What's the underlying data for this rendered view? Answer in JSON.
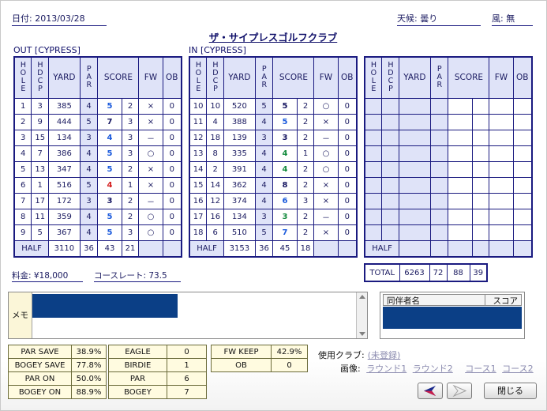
{
  "header": {
    "date": "日付: 2013/03/28",
    "weather": "天候: 曇り",
    "wind": "風: 無",
    "club_name": "ザ・サイプレスゴルフクラブ"
  },
  "sections": {
    "out_label": "OUT [CYPRESS]",
    "in_label": "IN [CYPRESS]"
  },
  "columns": [
    "HOLE",
    "HDCP",
    "YARD",
    "PAR",
    "SCORE",
    "FW",
    "OB"
  ],
  "out_holes": [
    {
      "hole": "1",
      "hdcp": "3",
      "yard": "385",
      "par": "4",
      "score": "5",
      "putts": "2",
      "fw": "×",
      "ob": "0",
      "color": "blue"
    },
    {
      "hole": "2",
      "hdcp": "9",
      "yard": "444",
      "par": "5",
      "score": "7",
      "putts": "3",
      "fw": "×",
      "ob": "0",
      "color": "navy"
    },
    {
      "hole": "3",
      "hdcp": "15",
      "yard": "134",
      "par": "3",
      "score": "4",
      "putts": "3",
      "fw": "－",
      "ob": "0",
      "color": "blue"
    },
    {
      "hole": "4",
      "hdcp": "7",
      "yard": "386",
      "par": "4",
      "score": "5",
      "putts": "3",
      "fw": "○",
      "ob": "0",
      "color": "blue"
    },
    {
      "hole": "5",
      "hdcp": "13",
      "yard": "347",
      "par": "4",
      "score": "5",
      "putts": "2",
      "fw": "×",
      "ob": "0",
      "color": "blue"
    },
    {
      "hole": "6",
      "hdcp": "1",
      "yard": "516",
      "par": "5",
      "score": "4",
      "putts": "1",
      "fw": "×",
      "ob": "0",
      "color": "red"
    },
    {
      "hole": "7",
      "hdcp": "17",
      "yard": "172",
      "par": "3",
      "score": "3",
      "putts": "2",
      "fw": "－",
      "ob": "0",
      "color": "navy"
    },
    {
      "hole": "8",
      "hdcp": "11",
      "yard": "359",
      "par": "4",
      "score": "5",
      "putts": "2",
      "fw": "○",
      "ob": "0",
      "color": "blue"
    },
    {
      "hole": "9",
      "hdcp": "5",
      "yard": "367",
      "par": "4",
      "score": "5",
      "putts": "3",
      "fw": "○",
      "ob": "0",
      "color": "blue"
    }
  ],
  "out_half": {
    "label": "HALF",
    "yard": "3110",
    "par": "36",
    "score": "43",
    "putts": "21"
  },
  "in_holes": [
    {
      "hole": "10",
      "hdcp": "10",
      "yard": "520",
      "par": "5",
      "score": "5",
      "putts": "2",
      "fw": "○",
      "ob": "0",
      "color": "navy"
    },
    {
      "hole": "11",
      "hdcp": "4",
      "yard": "388",
      "par": "4",
      "score": "5",
      "putts": "2",
      "fw": "×",
      "ob": "0",
      "color": "blue"
    },
    {
      "hole": "12",
      "hdcp": "18",
      "yard": "139",
      "par": "3",
      "score": "3",
      "putts": "2",
      "fw": "－",
      "ob": "0",
      "color": "navy"
    },
    {
      "hole": "13",
      "hdcp": "8",
      "yard": "335",
      "par": "4",
      "score": "4",
      "putts": "1",
      "fw": "○",
      "ob": "0",
      "color": "green"
    },
    {
      "hole": "14",
      "hdcp": "2",
      "yard": "391",
      "par": "4",
      "score": "4",
      "putts": "2",
      "fw": "○",
      "ob": "0",
      "color": "green"
    },
    {
      "hole": "15",
      "hdcp": "14",
      "yard": "362",
      "par": "4",
      "score": "8",
      "putts": "2",
      "fw": "×",
      "ob": "0",
      "color": "navy"
    },
    {
      "hole": "16",
      "hdcp": "12",
      "yard": "374",
      "par": "4",
      "score": "6",
      "putts": "3",
      "fw": "×",
      "ob": "0",
      "color": "blue"
    },
    {
      "hole": "17",
      "hdcp": "16",
      "yard": "134",
      "par": "3",
      "score": "3",
      "putts": "2",
      "fw": "－",
      "ob": "0",
      "color": "green"
    },
    {
      "hole": "18",
      "hdcp": "6",
      "yard": "510",
      "par": "5",
      "score": "7",
      "putts": "2",
      "fw": "×",
      "ob": "0",
      "color": "blue"
    }
  ],
  "in_half": {
    "label": "HALF",
    "yard": "3153",
    "par": "36",
    "score": "45",
    "putts": "18"
  },
  "extra_half_label": "HALF",
  "total": {
    "label": "TOTAL",
    "yard": "6263",
    "par": "72",
    "score": "88",
    "putts": "39"
  },
  "fee": "料金:  ¥18,000",
  "course_rate": "コースレート:  73.5",
  "memo": {
    "label": "メモ"
  },
  "companions": {
    "name_header": "同伴者名",
    "score_header": "スコア"
  },
  "stats": {
    "rates": [
      {
        "label": "PAR SAVE",
        "value": "38.9%"
      },
      {
        "label": "BOGEY SAVE",
        "value": "77.8%"
      },
      {
        "label": "PAR ON",
        "value": "50.0%"
      },
      {
        "label": "BOGEY ON",
        "value": "88.9%"
      }
    ],
    "counts": [
      {
        "label": "EAGLE",
        "value": "0"
      },
      {
        "label": "BIRDIE",
        "value": "1"
      },
      {
        "label": "PAR",
        "value": "6"
      },
      {
        "label": "BOGEY",
        "value": "7"
      }
    ],
    "fw": [
      {
        "label": "FW KEEP",
        "value": "42.9%"
      },
      {
        "label": "OB",
        "value": "0"
      }
    ]
  },
  "clubs": {
    "label": "使用クラブ:",
    "value": "(未登録)"
  },
  "photos": {
    "label": "画像:",
    "links": [
      "ラウンド1",
      "ラウンド2",
      "コース1",
      "コース2"
    ]
  },
  "buttons": {
    "close": "閉じる"
  },
  "colors": {
    "blue": "#1a5adc",
    "red": "#d41e1e",
    "green": "#128a3c",
    "navy": "#151560",
    "border": "#1a1a80",
    "shade": "#dfe3f8"
  }
}
